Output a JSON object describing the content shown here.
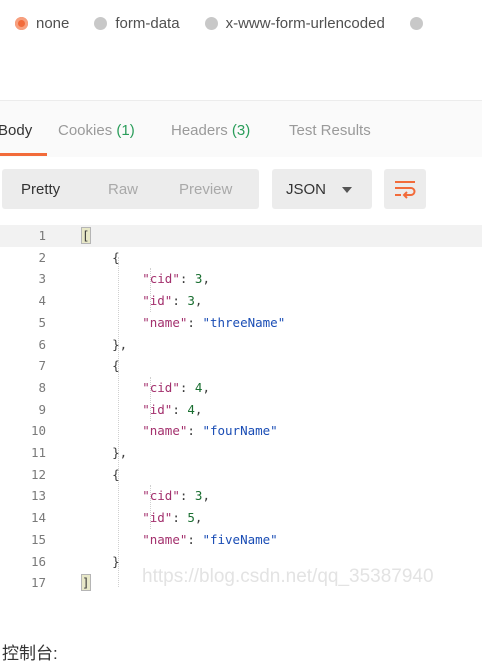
{
  "body_types": [
    {
      "label": "none",
      "selected": true
    },
    {
      "label": "form-data",
      "selected": false
    },
    {
      "label": "x-www-form-urlencoded",
      "selected": false
    }
  ],
  "response_tabs": {
    "body": "Body",
    "cookies": "Cookies",
    "cookies_count": "(1)",
    "headers": "Headers",
    "headers_count": "(3)",
    "test_results": "Test Results"
  },
  "view_modes": {
    "pretty": "Pretty",
    "raw": "Raw",
    "preview": "Preview"
  },
  "format": "JSON",
  "wrap_icon": "wrap-lines-icon",
  "accent_color": "#f26b3a",
  "lines": [
    {
      "n": "1"
    },
    {
      "n": "2"
    },
    {
      "n": "3"
    },
    {
      "n": "4"
    },
    {
      "n": "5"
    },
    {
      "n": "6"
    },
    {
      "n": "7"
    },
    {
      "n": "8"
    },
    {
      "n": "9"
    },
    {
      "n": "10"
    },
    {
      "n": "11"
    },
    {
      "n": "12"
    },
    {
      "n": "13"
    },
    {
      "n": "14"
    },
    {
      "n": "15"
    },
    {
      "n": "16"
    },
    {
      "n": "17"
    }
  ],
  "records": [
    {
      "cid": "3",
      "id": "3",
      "name": "\"threeName\""
    },
    {
      "cid": "4",
      "id": "4",
      "name": "\"fourName\""
    },
    {
      "cid": "3",
      "id": "5",
      "name": "\"fiveName\""
    }
  ],
  "keys": {
    "cid": "\"cid\"",
    "id": "\"id\"",
    "name": "\"name\""
  },
  "punct": {
    "open_array": "[",
    "close_array": "]",
    "open_obj": "{",
    "close_obj_comma": "},",
    "close_obj": "}",
    "colon": ": ",
    "comma": ","
  },
  "watermark": "https://blog.csdn.net/qq_35387940",
  "console_label": "控制台:"
}
